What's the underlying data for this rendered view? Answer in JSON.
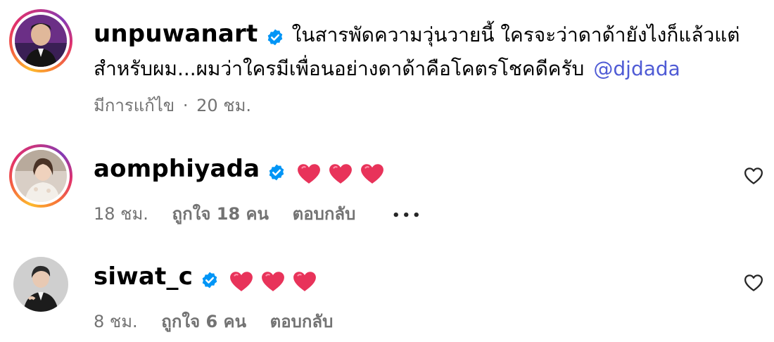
{
  "caption": {
    "username": "unpuwanart",
    "text_line1": "ในสารพัดความวุ่นวายนี้ ใครจะว่าดาด้ายังไงก็แล้วแต่",
    "text_line2": "สำหรับผม...ผมว่าใครมีเพื่อนอย่างดาด้าคือโคตรโชคดีครับ",
    "mention": "@djdada",
    "edited": "มีการแก้ไข",
    "separator": "·",
    "time": "20 ชม."
  },
  "comments": [
    {
      "username": "aomphiyada",
      "text": "❤️❤️❤️",
      "time": "18 ชม.",
      "likes": "ถูกใจ 18 คน",
      "reply": "ตอบกลับ",
      "more": "•••"
    },
    {
      "username": "siwat_c",
      "text": "❤️❤️❤️",
      "time": "8 ชม.",
      "likes": "ถูกใจ 6 คน",
      "reply": "ตอบกลับ"
    }
  ],
  "icons": {
    "verified": "verified-badge-icon",
    "like": "heart-outline-icon",
    "emoji_heart": "red-heart-emoji"
  },
  "colors": {
    "verified_blue": "#0095f6",
    "mention_blue": "#4f5bd5",
    "secondary_text": "#737373",
    "emoji_heart": "#e8335a"
  }
}
